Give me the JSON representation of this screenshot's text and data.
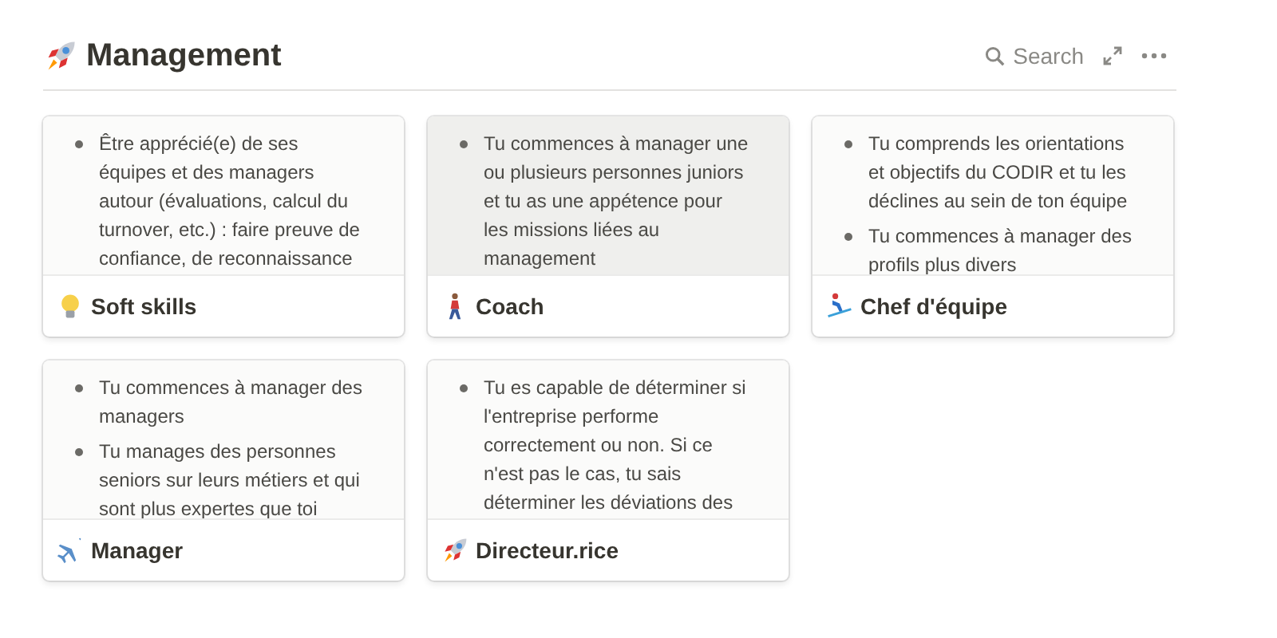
{
  "header": {
    "title": "Management",
    "search_label": "Search"
  },
  "cards": [
    {
      "kind": "bulb",
      "title": "Soft skills",
      "highlighted": false,
      "bullets": [
        "Être apprécié(e) de ses équipes et des managers autour (évaluations, calcul du turnover, etc.) : faire preuve de confiance, de reconnaissance"
      ]
    },
    {
      "kind": "walker",
      "title": "Coach",
      "highlighted": true,
      "bullets": [
        "Tu commences à manager une ou plusieurs personnes juniors et tu as une appétence pour les missions liées au management"
      ]
    },
    {
      "kind": "skier",
      "title": "Chef d'équipe",
      "highlighted": false,
      "bullets": [
        "Tu comprends les orientations et objectifs du CODIR et tu les déclines au sein de ton équipe",
        "Tu commences à manager des profils plus divers"
      ]
    },
    {
      "kind": "plane",
      "title": "Manager",
      "highlighted": false,
      "bullets": [
        "Tu commences à manager des managers",
        "Tu manages des personnes seniors sur leurs métiers et qui sont plus expertes que toi"
      ]
    },
    {
      "kind": "rocket",
      "title": "Directeur.rice",
      "highlighted": false,
      "bullets": [
        "Tu es capable de déterminer si l'entreprise performe correctement ou non. Si ce n'est pas le cas, tu sais déterminer les déviations des"
      ]
    }
  ]
}
